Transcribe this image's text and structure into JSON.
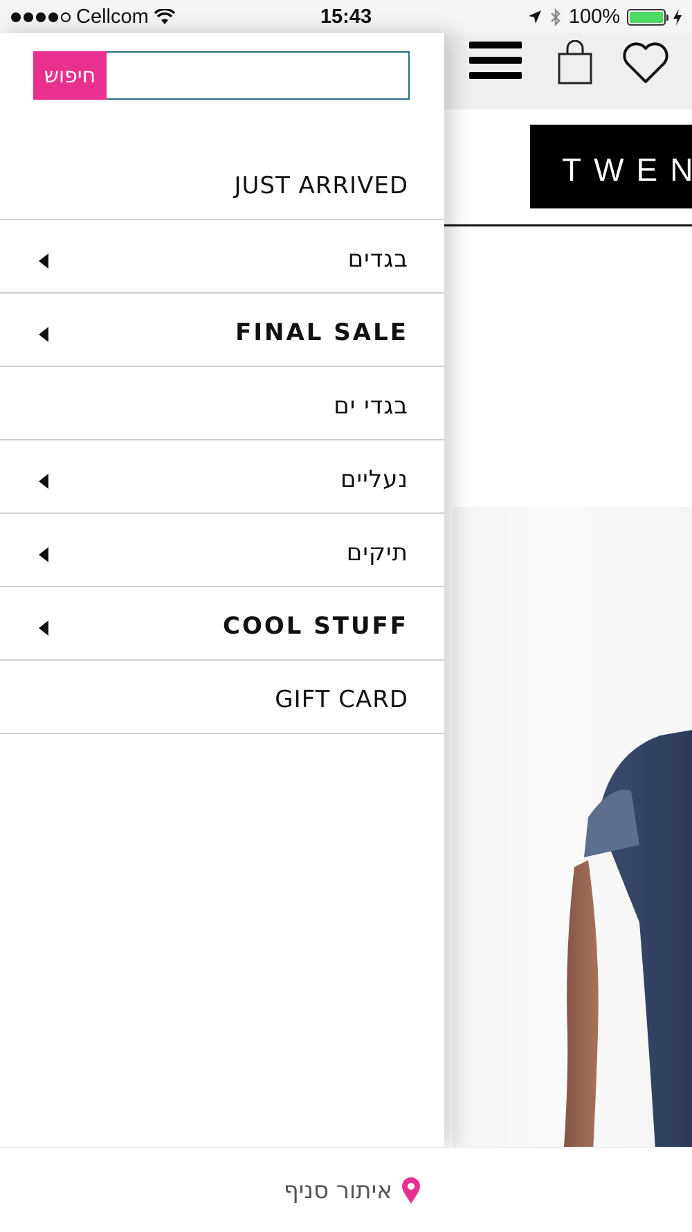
{
  "status_bar": {
    "carrier": "Cellcom",
    "time": "15:43",
    "battery": "100%",
    "signal_bars_filled": 4,
    "signal_bars_total": 5
  },
  "colors": {
    "accent": "#e8308f",
    "input_border": "#2a6d82",
    "battery_fill": "#4cd964"
  },
  "search": {
    "button_label": "חיפוש",
    "input_value": "",
    "placeholder": ""
  },
  "menu": {
    "items": [
      {
        "label": "JUST ARRIVED",
        "has_submenu": false
      },
      {
        "label": "בגדים",
        "has_submenu": true
      },
      {
        "label": "FINAL SALE",
        "has_submenu": true
      },
      {
        "label": "בגדי ים",
        "has_submenu": false
      },
      {
        "label": "נעליים",
        "has_submenu": true
      },
      {
        "label": "תיקים",
        "has_submenu": true
      },
      {
        "label": "COOL STUFF",
        "has_submenu": true
      },
      {
        "label": "GIFT CARD",
        "has_submenu": false
      }
    ]
  },
  "header": {
    "logo_text": "TWEN",
    "icons": [
      "hamburger-menu-icon",
      "shopping-bag-icon",
      "heart-icon"
    ]
  },
  "footer": {
    "store_locator_label": "איתור סניף",
    "icon": "location-pin-icon"
  }
}
